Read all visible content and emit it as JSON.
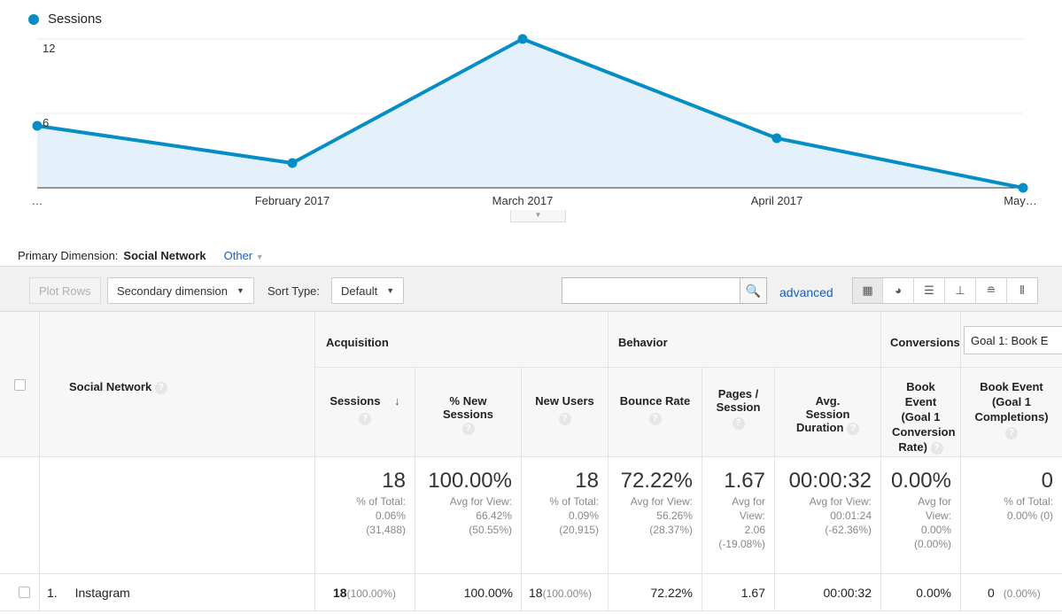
{
  "chart_data": {
    "type": "line",
    "legend": [
      {
        "name": "Sessions",
        "color": "#058dc7"
      }
    ],
    "x": [
      "…",
      "February 2017",
      "March 2017",
      "April 2017",
      "May…"
    ],
    "x_tick_labels": [
      "…",
      "February 2017",
      "March 2017",
      "April 2017",
      "May…"
    ],
    "series": [
      {
        "name": "Sessions",
        "values": [
          5,
          2,
          12,
          4,
          0
        ],
        "color": "#058dc7"
      }
    ],
    "y_tick_labels": [
      "6",
      "12"
    ],
    "ylim": [
      0,
      12
    ],
    "grid": true,
    "area_fill": "#e4f1fa"
  },
  "primary_dimension": {
    "label": "Primary Dimension:",
    "selected": "Social Network",
    "other": "Other"
  },
  "toolbar": {
    "plot_rows": "Plot Rows",
    "secondary_dimension": "Secondary dimension",
    "sort_type_label": "Sort Type:",
    "sort_type_value": "Default",
    "search_value": "",
    "advanced": "advanced"
  },
  "table": {
    "dimension_header": "Social Network",
    "groups": {
      "acquisition": "Acquisition",
      "behavior": "Behavior",
      "conversions": "Conversions",
      "goal_select": "Goal 1: Book E"
    },
    "columns": [
      {
        "label": "Sessions"
      },
      {
        "label": "% New Sessions"
      },
      {
        "label": "New Users"
      },
      {
        "label": "Bounce Rate"
      },
      {
        "label": "Pages / Session"
      },
      {
        "label": "Avg. Session Duration"
      },
      {
        "label": "Book Event (Goal 1 Conversion Rate)"
      },
      {
        "label": "Book Event (Goal 1 Completions)"
      }
    ],
    "totals": [
      {
        "value": "18",
        "sub": [
          "% of Total:",
          "0.06%",
          "(31,488)"
        ]
      },
      {
        "value": "100.00%",
        "sub": [
          "Avg for View:",
          "66.42%",
          "(50.55%)"
        ]
      },
      {
        "value": "18",
        "sub": [
          "% of Total:",
          "0.09%",
          "(20,915)"
        ]
      },
      {
        "value": "72.22%",
        "sub": [
          "Avg for View:",
          "56.26%",
          "(28.37%)"
        ]
      },
      {
        "value": "1.67",
        "sub": [
          "Avg for",
          "View:",
          "2.06",
          "(-19.08%)"
        ]
      },
      {
        "value": "00:00:32",
        "sub": [
          "Avg for View:",
          "00:01:24",
          "(-62.36%)"
        ]
      },
      {
        "value": "0.00%",
        "sub": [
          "Avg for",
          "View:",
          "0.00%",
          "(0.00%)"
        ]
      },
      {
        "value": "0",
        "sub": [
          "% of Total:",
          "0.00% (0)"
        ]
      }
    ],
    "rows": [
      {
        "index": "1.",
        "name": "Instagram",
        "cells": [
          "18",
          "(100.00%)",
          "100.00%",
          "18",
          "(100.00%)",
          "72.22%",
          "1.67",
          "00:00:32",
          "0.00%",
          "0",
          "(0.00%)"
        ]
      }
    ]
  }
}
